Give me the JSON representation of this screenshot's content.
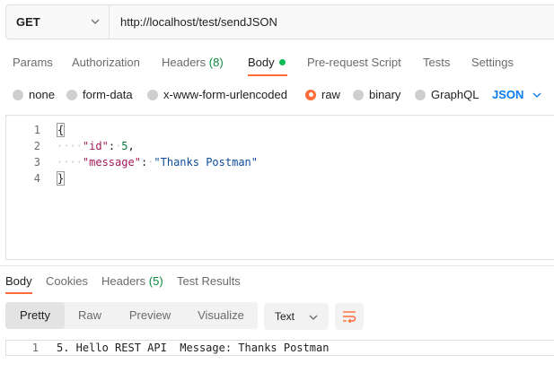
{
  "request": {
    "method": "GET",
    "url": "http://localhost/test/sendJSON"
  },
  "tabs": {
    "params": "Params",
    "authorization": "Authorization",
    "headers_label": "Headers",
    "headers_count": "(8)",
    "body": "Body",
    "prerequest": "Pre-request Script",
    "tests": "Tests",
    "settings": "Settings"
  },
  "body_types": {
    "none": "none",
    "form_data": "form-data",
    "urlencoded": "x-www-form-urlencoded",
    "raw": "raw",
    "binary": "binary",
    "graphql": "GraphQL",
    "selected": "raw",
    "format": "JSON"
  },
  "editor": {
    "lines": [
      {
        "n": "1",
        "open": "{"
      },
      {
        "n": "2",
        "key": "\"id\"",
        "sep": ":",
        "value": "5",
        "trail": ","
      },
      {
        "n": "3",
        "key": "\"message\"",
        "sep": ":",
        "value": "\"Thanks Postman\""
      },
      {
        "n": "4",
        "close": "}"
      }
    ]
  },
  "response": {
    "tabs": {
      "body": "Body",
      "cookies": "Cookies",
      "headers_label": "Headers",
      "headers_count": "(5)",
      "test_results": "Test Results"
    },
    "view_modes": {
      "pretty": "Pretty",
      "raw": "Raw",
      "preview": "Preview",
      "visualize": "Visualize"
    },
    "format": "Text",
    "lines": [
      {
        "n": "1",
        "text": "5. Hello REST API  Message: Thanks Postman"
      }
    ]
  },
  "colors": {
    "accent": "#ff6c37",
    "link_blue": "#097bed",
    "status_green": "#0cbb52"
  }
}
